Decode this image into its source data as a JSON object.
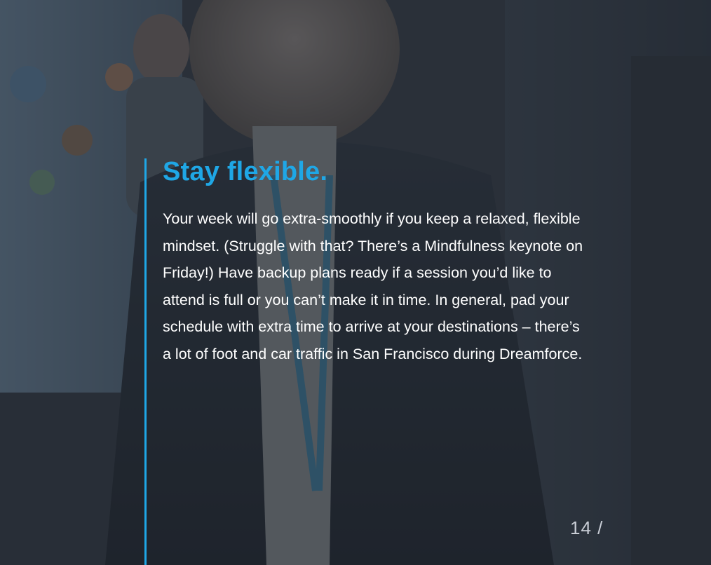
{
  "slide": {
    "title": "Stay flexible.",
    "body": "Your week will go extra-smoothly if you keep a relaxed, flexible mindset. (Struggle with that? There’s a Mindfulness keynote on Friday!) Have backup plans ready if a session you’d like to attend is full or you can’t make it in time. In general, pad your schedule with extra time to arrive at your destinations – there’s a lot of foot and car traffic in San Francisco during Dreamforce.",
    "page_number": "14 /"
  },
  "colors": {
    "accent": "#1fa7e6",
    "body_text": "#ffffff",
    "page_number": "#c9ced6",
    "overlay": "#222830"
  }
}
